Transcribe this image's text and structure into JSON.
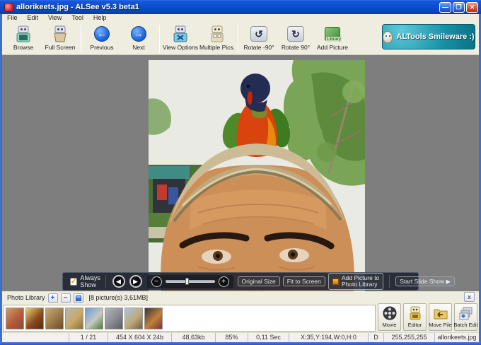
{
  "window": {
    "title": "allorikeets.jpg - ALSee v5.3 beta1",
    "controls": {
      "minimize": "—",
      "maximize": "❐",
      "close": "✕"
    }
  },
  "menu": {
    "items": [
      "File",
      "Edit",
      "View",
      "Tool",
      "Help"
    ]
  },
  "toolbar": {
    "buttons": [
      {
        "label": "Browse"
      },
      {
        "label": "Full Screen"
      },
      {
        "label": "Previous"
      },
      {
        "label": "Next"
      },
      {
        "label": "View Options"
      },
      {
        "label": "Multiple Pics."
      },
      {
        "label": "Rotate -90°"
      },
      {
        "label": "Rotate 90°"
      },
      {
        "label": "Add Picture",
        "badge": "Library"
      }
    ],
    "icons": {
      "previous": "←",
      "next": "→",
      "rotate_ccw": "↺",
      "rotate_cw": "↻"
    },
    "altools_label": "ALTools Smileware :)"
  },
  "viewer": {
    "controls": {
      "always_show": "Always Show",
      "check_glyph": "✓",
      "prev_glyph": "◀",
      "next_glyph": "▶",
      "zoom_out": "−",
      "zoom_in": "+",
      "original_size": "Original Size",
      "fit_to_screen": "Fit to Screen",
      "add_to_library_line1": "Add Picture to",
      "add_to_library_line2": "Photo Library",
      "start_slideshow": "Start Slide Show ▶"
    }
  },
  "library": {
    "title": "Photo Library",
    "add_glyph": "+",
    "remove_glyph": "−",
    "close_glyph": "x",
    "count_text": "[8 picture(s) 3,61MB]",
    "thumbnails": [
      {
        "name": "lorikeet-portrait",
        "colors": [
          "#c9a06a",
          "#b35a3a",
          "#8a4a3a"
        ]
      },
      {
        "name": "food-plate",
        "colors": [
          "#e8d070",
          "#8a4a20",
          "#5a2a10"
        ]
      },
      {
        "name": "camel-ride",
        "colors": [
          "#c8a878",
          "#9a7848",
          "#6a4828"
        ]
      },
      {
        "name": "pyramid-sphinx",
        "colors": [
          "#b8b8b0",
          "#c8a868",
          "#8a7040"
        ]
      },
      {
        "name": "church-blue-sky",
        "colors": [
          "#6a9ad8",
          "#c8c8c0",
          "#4a7a3a"
        ]
      },
      {
        "name": "tower-bridge",
        "colors": [
          "#b0b4b8",
          "#888c90",
          "#5a5e62"
        ]
      },
      {
        "name": "big-ben",
        "colors": [
          "#a8c4e0",
          "#c0a878",
          "#706048"
        ]
      },
      {
        "name": "temple-night",
        "colors": [
          "#3a3438",
          "#c08038",
          "#7a3048"
        ]
      }
    ],
    "actions": [
      {
        "label": "Movie"
      },
      {
        "label": "Editor"
      },
      {
        "label": "Move File"
      },
      {
        "label": "Batch Edit"
      }
    ]
  },
  "statusbar": {
    "cells": [
      "",
      "1 / 21",
      "454 X 604 X 24b",
      "48,63kb",
      "85%",
      "0,11 Sec",
      "X:35,Y:194,W:0,H:0",
      "D",
      "255,255,255",
      "allorikeets.jpg"
    ]
  },
  "colors": {
    "titlebar_blue": "#0f4fd4",
    "toolbar_bg": "#EFEDE0",
    "viewer_gray": "#7E7E7E",
    "altools_teal": "#1690a4",
    "overlay_dark": "#1a202c"
  }
}
